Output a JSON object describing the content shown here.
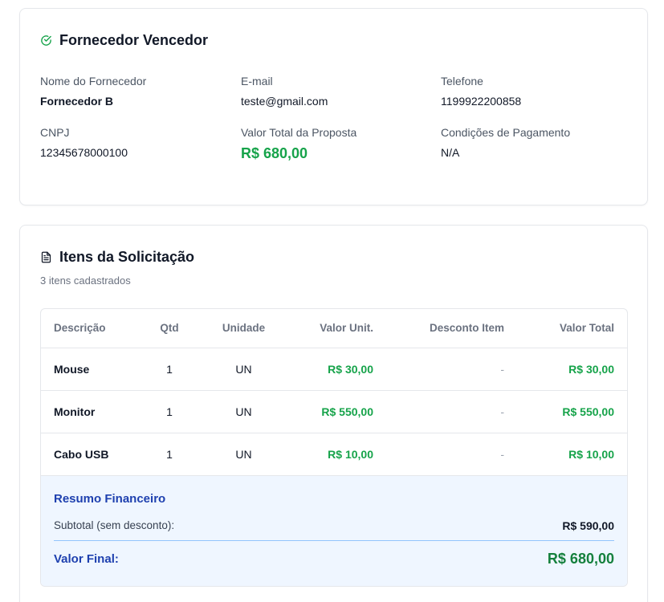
{
  "winner": {
    "title": "Fornecedor Vencedor",
    "fields": {
      "supplier_name_label": "Nome do Fornecedor",
      "supplier_name": "Fornecedor B",
      "email_label": "E-mail",
      "email": "teste@gmail.com",
      "phone_label": "Telefone",
      "phone": "1199922200858",
      "cnpj_label": "CNPJ",
      "cnpj": "12345678000100",
      "total_label": "Valor Total da Proposta",
      "total": "R$ 680,00",
      "payment_label": "Condições de Pagamento",
      "payment": "N/A"
    }
  },
  "items": {
    "title": "Itens da Solicitação",
    "subtitle": "3 itens cadastrados",
    "columns": {
      "description": "Descrição",
      "qty": "Qtd",
      "unit": "Unidade",
      "unit_value": "Valor Unit.",
      "item_discount": "Desconto Item",
      "total_value": "Valor Total"
    },
    "rows": [
      {
        "description": "Mouse",
        "qty": "1",
        "unit": "UN",
        "unit_value": "R$ 30,00",
        "discount": "-",
        "total": "R$ 30,00"
      },
      {
        "description": "Monitor",
        "qty": "1",
        "unit": "UN",
        "unit_value": "R$ 550,00",
        "discount": "-",
        "total": "R$ 550,00"
      },
      {
        "description": "Cabo USB",
        "qty": "1",
        "unit": "UN",
        "unit_value": "R$ 10,00",
        "discount": "-",
        "total": "R$ 10,00"
      }
    ],
    "summary": {
      "title": "Resumo Financeiro",
      "subtotal_label": "Subtotal (sem desconto):",
      "subtotal": "R$ 590,00",
      "final_label": "Valor Final:",
      "final": "R$ 680,00"
    }
  },
  "colors": {
    "success": "#16a34a",
    "accent_blue": "#1e40af",
    "summary_bg": "#eff6ff"
  },
  "icons": {
    "winner": "check-circle-icon",
    "items": "document-icon"
  }
}
